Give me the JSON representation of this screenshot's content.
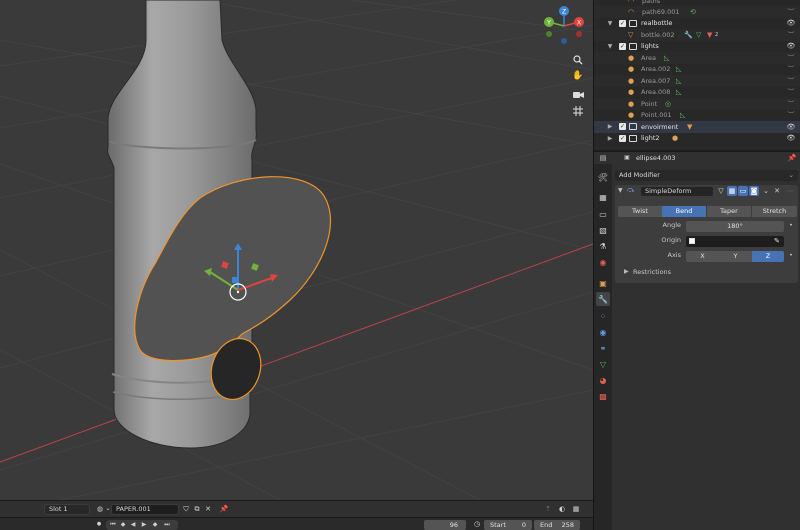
{
  "viewport": {
    "nav_gizmo": {
      "x_label": "X",
      "y_label": "Y",
      "z_label": "Z"
    },
    "buttons": {
      "zoom": "zoom-icon",
      "pan": "hand-icon",
      "camera": "camera-icon",
      "grid": "grid-icon"
    }
  },
  "outliner": {
    "rows": [
      {
        "label": "paths",
        "dim": true
      },
      {
        "label": "path69.001",
        "dim": true
      },
      {
        "label": "realbottle",
        "dim": false
      },
      {
        "label": "bottle.002",
        "dim": true,
        "badge": "2"
      },
      {
        "label": "lights",
        "dim": false
      },
      {
        "label": "Area",
        "dim": true
      },
      {
        "label": "Area.002",
        "dim": true
      },
      {
        "label": "Area.007",
        "dim": true
      },
      {
        "label": "Area.008",
        "dim": true
      },
      {
        "label": "Point",
        "dim": true
      },
      {
        "label": "Point.001",
        "dim": true
      },
      {
        "label": "envoirment",
        "dim": false
      },
      {
        "label": "light2",
        "dim": false
      }
    ]
  },
  "properties": {
    "object_name": "ellipse4.003",
    "add_modifier": "Add Modifier",
    "modifier_name": "SimpleDeform",
    "modes": [
      "Twist",
      "Bend",
      "Taper",
      "Stretch"
    ],
    "active_mode": "Bend",
    "angle_label": "Angle",
    "angle_value": "180°",
    "origin_label": "Origin",
    "axis_label": "Axis",
    "axes": [
      "X",
      "Y",
      "Z"
    ],
    "active_axis": "Z",
    "restrictions": "Restrictions"
  },
  "image_bar": {
    "slot": "Slot 1",
    "image_name": "PAPER.001"
  },
  "timeline": {
    "current_frame": "96",
    "start_label": "Start",
    "start_value": "0",
    "end_label": "End",
    "end_value": "258"
  },
  "colors": {
    "accent": "#4772b3",
    "selection_outline": "#f0932b",
    "x_axis": "#e0443e",
    "y_axis": "#6fb33a",
    "z_axis": "#3b85d9"
  }
}
